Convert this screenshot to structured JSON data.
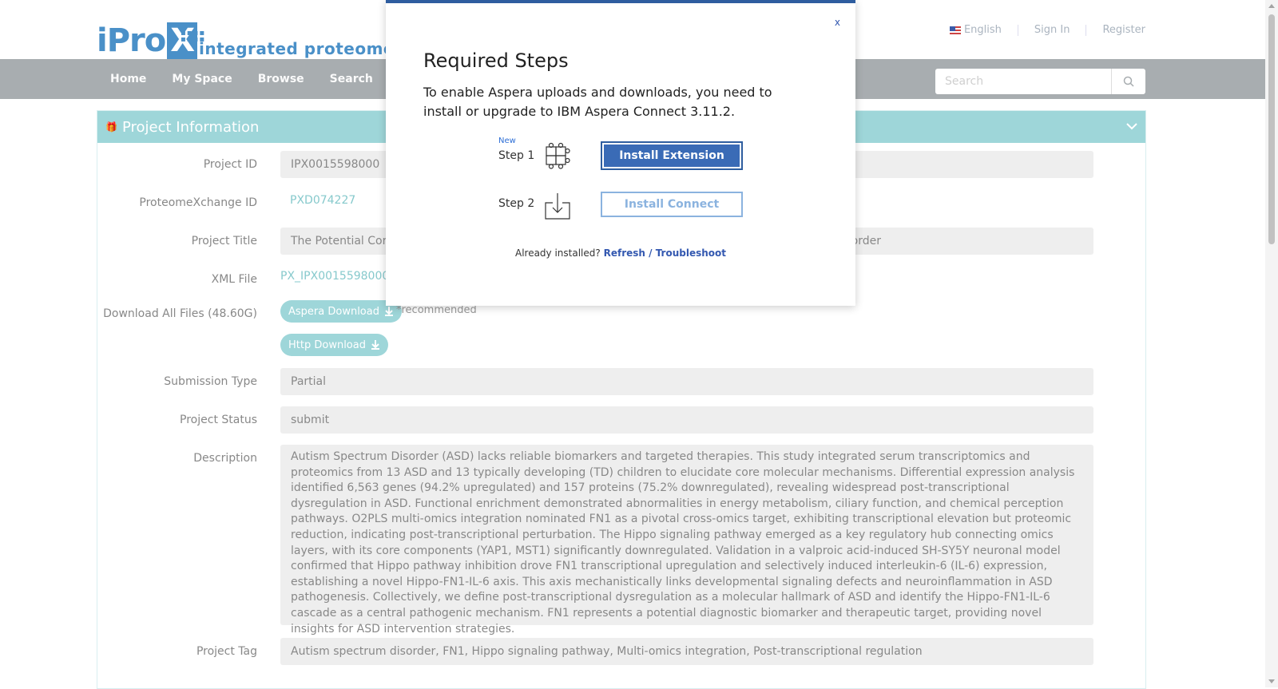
{
  "header": {
    "logo_text": "iProX",
    "tagline": "integrated proteome re",
    "language": "English",
    "sign_in": "Sign In",
    "register": "Register"
  },
  "nav": {
    "items": [
      "Home",
      "My Space",
      "Browse",
      "Search"
    ],
    "search_placeholder": "Search"
  },
  "panel": {
    "title": "Project Information",
    "rows": {
      "project_id_label": "Project ID",
      "project_id": "IPX0015598000",
      "px_id_label": "ProteomeXchange ID",
      "px_id": "PXD074227",
      "title_label": "Project Title",
      "title_left": "The Potential Core",
      "title_right": "order",
      "xml_label": "XML File",
      "xml_file": "PX_IPX0015598000.x",
      "download_label": "Download All Files (48.60G)",
      "aspera_btn": "Aspera Download",
      "recommended": "*recommended",
      "http_btn": "Http Download",
      "submission_type_label": "Submission Type",
      "submission_type": "Partial",
      "status_label": "Project Status",
      "status": "submit",
      "description_label": "Description",
      "description": "Autism Spectrum Disorder (ASD) lacks reliable biomarkers and targeted therapies. This study integrated serum transcriptomics and proteomics from 13 ASD and 13 typically developing (TD) children to elucidate core molecular mechanisms. Differential expression analysis identified 6,563 genes (94.2% upregulated) and 157 proteins (75.2% downregulated), revealing widespread post-transcriptional dysregulation in ASD. Functional enrichment demonstrated abnormalities in energy metabolism, ciliary function, and chemical perception pathways. O2PLS multi-omics integration nominated FN1 as a pivotal cross-omics target, exhibiting transcriptional elevation but proteomic reduction, indicating post-transcriptional perturbation. The Hippo signaling pathway emerged as a key regulatory hub connecting omics layers, with its core components (YAP1, MST1) significantly downregulated. Validation in a valproic acid-induced SH-SY5Y neuronal model confirmed that Hippo pathway inhibition drove FN1 transcriptional upregulation and selectively induced interleukin-6 (IL-6) expression, establishing a novel Hippo-FN1-IL-6 axis. This axis mechanistically links developmental signaling defects and neuroinflammation in ASD pathogenesis. Collectively, we define post-transcriptional dysregulation as a molecular hallmark of ASD and identify the Hippo-FN1-IL-6 cascade as a central pathogenic mechanism. FN1 represents a potential diagnostic biomarker and therapeutic target, providing novel insights for ASD intervention strategies.",
      "tag_label": "Project Tag",
      "tags": "Autism spectrum disorder, FN1, Hippo signaling pathway, Multi-omics integration, Post-transcriptional regulation"
    }
  },
  "modal": {
    "close": "x",
    "title": "Required Steps",
    "text": "To enable Aspera uploads and downloads, you need to install or upgrade to IBM Aspera Connect 3.11.2.",
    "step1_new": "New",
    "step1_label": "Step 1",
    "step1_button": "Install Extension",
    "step2_label": "Step 2",
    "step2_button": "Install Connect",
    "already": "Already installed?",
    "refresh": "Refresh",
    "slash": " / ",
    "troubleshoot": "Troubleshoot"
  },
  "colors": {
    "accent": "#9ed6d9",
    "nav": "#a8adb0",
    "modal_primary": "#3a6bb6",
    "link": "#3358b0"
  },
  "icons": [
    "search-icon",
    "gift-icon",
    "chevron-down-icon",
    "download-icon",
    "puzzle-icon",
    "download-arrow-icon"
  ]
}
